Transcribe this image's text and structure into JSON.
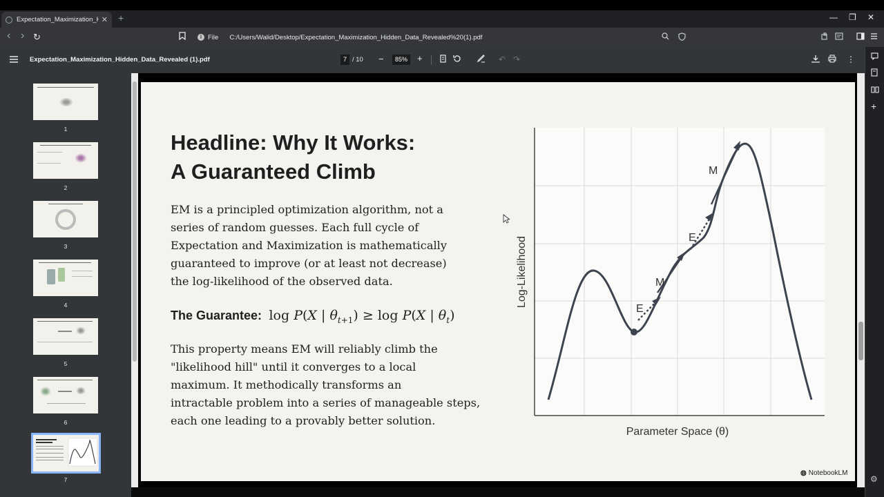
{
  "browser": {
    "tab_title": "Expectation_Maximization_Hidd",
    "tab_close": "✕",
    "new_tab": "+",
    "win_minimize": "—",
    "win_maximize": "❐",
    "win_close": "✕",
    "nav_back": "‹",
    "nav_forward": "›",
    "reload": "↻",
    "scheme_label": "File",
    "url": "C:/Users/Walid/Desktop/Expectation_Maximization_Hidden_Data_Revealed%20(1).pdf"
  },
  "pdf_toolbar": {
    "file_name": "Expectation_Maximization_Hidden_Data_Revealed (1).pdf",
    "current_page": "7",
    "page_total": "/ 10",
    "zoom": "85%",
    "zoom_out": "−",
    "zoom_in": "+"
  },
  "thumbnails": [
    {
      "number": "1"
    },
    {
      "number": "2"
    },
    {
      "number": "3"
    },
    {
      "number": "4"
    },
    {
      "number": "5"
    },
    {
      "number": "6"
    },
    {
      "number": "7",
      "active": true
    }
  ],
  "slide": {
    "headline_line1": "Headline: Why It Works:",
    "headline_line2": "A Guaranteed Climb",
    "body1_lines": [
      "EM is a principled optimization algorithm, not a",
      "series of random guesses. Each full cycle of",
      "Expectation and Maximization is mathematically",
      "guaranteed to improve (or at least not decrease)",
      "the log-likelihood of the observed data."
    ],
    "guarantee_label": "The Guarantee:",
    "body2_lines": [
      "This property means EM will reliably climb the",
      "\"likelihood hill\" until it converges to a local",
      "maximum. It methodically transforms an",
      "intractable problem into a series of manageable steps,",
      "each one leading to a provably better solution."
    ],
    "brand": "NotebookLM"
  },
  "chart_data": {
    "type": "line",
    "xlabel": "Parameter Space (θ)",
    "ylabel": "Log-Likelihood",
    "grid": true,
    "step_labels": [
      "E",
      "M",
      "E",
      "M"
    ]
  },
  "colors": {
    "accent_thumb": "#8ab4f8",
    "slide_bg": "#f4f3ef",
    "curve": "#3d4450"
  }
}
